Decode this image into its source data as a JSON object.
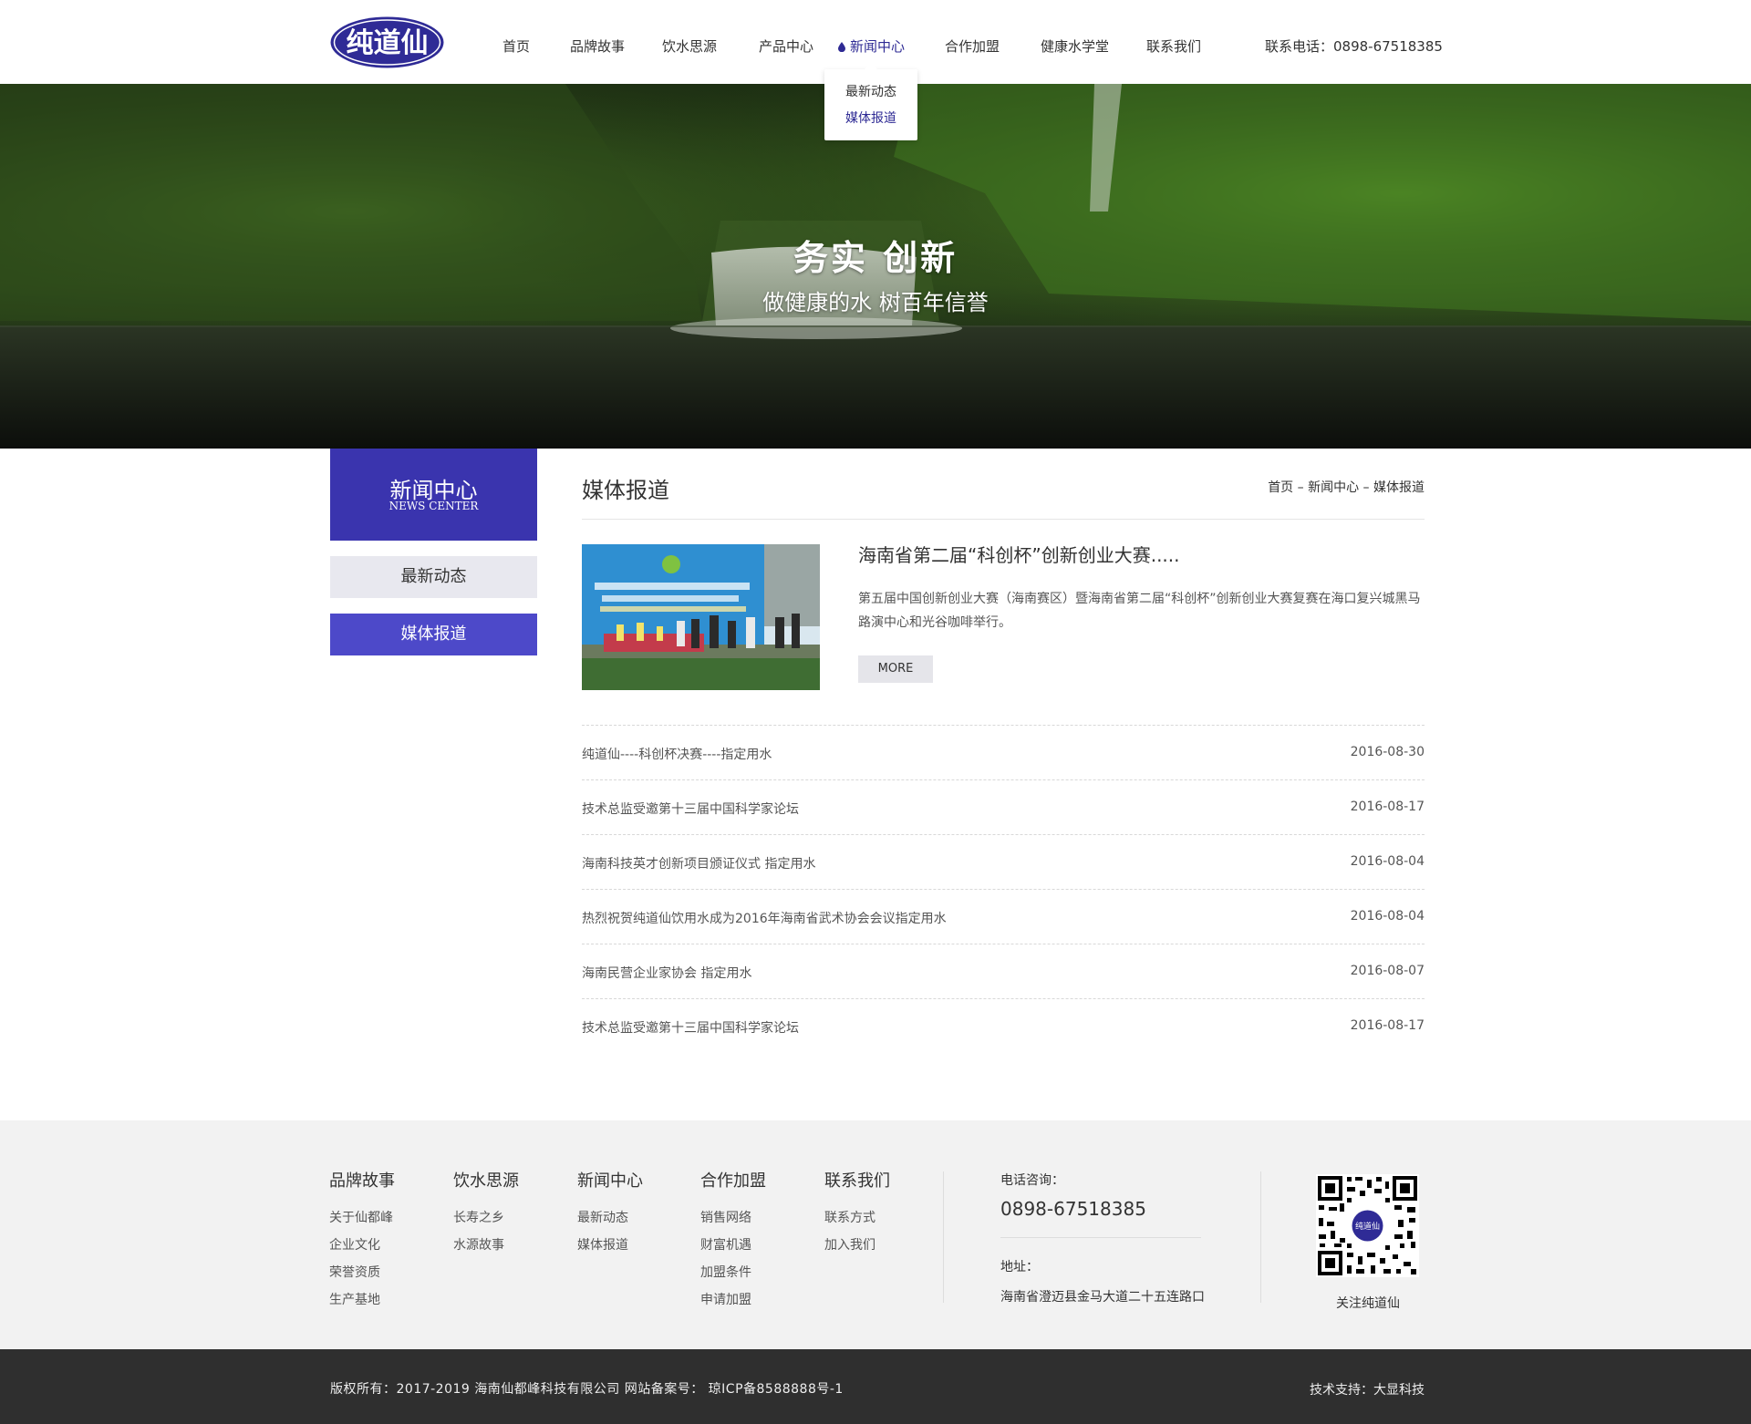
{
  "header": {
    "logo_text": "纯道仙",
    "nav": [
      {
        "label": "首页"
      },
      {
        "label": "品牌故事"
      },
      {
        "label": "饮水思源"
      },
      {
        "label": "产品中心"
      },
      {
        "label": "新闻中心"
      },
      {
        "label": "合作加盟"
      },
      {
        "label": "健康水学堂"
      },
      {
        "label": "联系我们"
      }
    ],
    "active_nav": "新闻中心",
    "contact": "联系电话：0898-67518385",
    "dropdown": [
      {
        "label": "最新动态"
      },
      {
        "label": "媒体报道"
      }
    ]
  },
  "banner": {
    "title": "务实  创新",
    "subtitle": "做健康的水 树百年信誉"
  },
  "sidebar": {
    "title_cn": "新闻中心",
    "title_en": "NEWS CENTER",
    "items": [
      {
        "label": "最新动态"
      },
      {
        "label": "媒体报道"
      }
    ],
    "active": "媒体报道"
  },
  "main": {
    "title": "媒体报道",
    "breadcrumb": "首页 – 新闻中心 – 媒体报道",
    "feature": {
      "title": "海南省第二届“科创杯”创新创业大赛.....",
      "desc": "第五届中国创新创业大赛（海南赛区）暨海南省第二届“科创杯”创新创业大赛复赛在海口复兴城黑马路演中心和光谷咖啡举行。",
      "more": "MORE",
      "image_caption": "海南省第二届“科创杯”创新创业大赛"
    },
    "news": [
      {
        "title": "纯道仙----科创杯决赛----指定用水",
        "date": "2016-08-30"
      },
      {
        "title": "技术总监受邀第十三届中国科学家论坛",
        "date": "2016-08-17"
      },
      {
        "title": "海南科技英才创新项目颁证仪式 指定用水",
        "date": "2016-08-04"
      },
      {
        "title": "热烈祝贺纯道仙饮用水成为2016年海南省武术协会会议指定用水",
        "date": "2016-08-04"
      },
      {
        "title": "海南民营企业家协会 指定用水",
        "date": "2016-08-07"
      },
      {
        "title": "技术总监受邀第十三届中国科学家论坛",
        "date": "2016-08-17"
      }
    ]
  },
  "footer": {
    "columns": [
      {
        "title": "品牌故事",
        "links": [
          "关于仙都峰",
          "企业文化",
          "荣誉资质",
          "生产基地"
        ]
      },
      {
        "title": "饮水思源",
        "links": [
          "长寿之乡",
          "水源故事"
        ]
      },
      {
        "title": "新闻中心",
        "links": [
          "最新动态",
          "媒体报道"
        ]
      },
      {
        "title": "合作加盟",
        "links": [
          "销售网络",
          "财富机遇",
          "加盟条件",
          "申请加盟"
        ]
      },
      {
        "title": "联系我们",
        "links": [
          "联系方式",
          "加入我们"
        ]
      }
    ],
    "tel_label": "电话咨询：",
    "tel": "0898-67518385",
    "addr_label": "地址：",
    "addr": "海南省澄迈县金马大道二十五连路口",
    "qr_caption": "关注纯道仙",
    "qr_logo_text": "纯道仙",
    "copyright": "版权所有：2017-2019 海南仙都峰科技有限公司   网站备案号： 琼ICP备8588888号-1",
    "tech": "技术支持：大显科技"
  },
  "colors": {
    "brand": "#3a34ae",
    "brand_active": "#4d49c9",
    "footer_bg": "#f2f2f2",
    "bottom_bg": "#2f2f2f"
  }
}
